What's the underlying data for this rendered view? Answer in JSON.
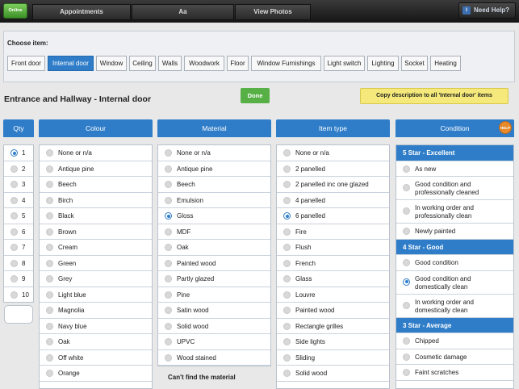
{
  "topbar": {
    "online_label": "Online",
    "tabs": [
      "Appointments",
      "Aa",
      "View Photos"
    ],
    "help_label": "Need Help?",
    "help_icon": "info-icon"
  },
  "choose": {
    "title": "Choose item:",
    "items": [
      "Front door",
      "Internal door",
      "Window",
      "Ceiling",
      "Walls",
      "Woodwork",
      "Floor",
      "Window Furnishings",
      "Light switch",
      "Lighting",
      "Socket",
      "Heating"
    ],
    "selected": "Internal door"
  },
  "section": {
    "title": "Entrance and Hallway - Internal door",
    "done_label": "Done",
    "copy_label": "Copy description to all 'Internal door' items"
  },
  "columns": {
    "qty": "Qty",
    "colour": "Colour",
    "material": "Material",
    "item_type": "Item type",
    "condition": "Condition",
    "help_badge": "HELP"
  },
  "qty": {
    "options": [
      "1",
      "2",
      "3",
      "4",
      "5",
      "6",
      "7",
      "8",
      "9",
      "10"
    ],
    "selected": "1"
  },
  "colour": {
    "options": [
      "None or n/a",
      "Antique pine",
      "Beech",
      "Birch",
      "Black",
      "Brown",
      "Cream",
      "Green",
      "Grey",
      "Light blue",
      "Magnolia",
      "Navy blue",
      "Oak",
      "Off white",
      "Orange"
    ]
  },
  "material": {
    "options": [
      "None or n/a",
      "Antique pine",
      "Beech",
      "Emulsion",
      "Gloss",
      "MDF",
      "Oak",
      "Painted wood",
      "Partly glazed",
      "Pine",
      "Satin wood",
      "Solid wood",
      "UPVC",
      "Wood stained"
    ],
    "selected": "Gloss",
    "cant_find": "Can't find the material"
  },
  "item_type": {
    "options": [
      "None or n/a",
      "2 panelled",
      "2 panelled inc one glazed",
      "4 panelled",
      "6 panelled",
      "Fire",
      "Flush",
      "French",
      "Glass",
      "Louvre",
      "Painted wood",
      "Rectangle grilles",
      "Side lights",
      "Sliding",
      "Solid wood"
    ],
    "selected": "6 panelled"
  },
  "condition": {
    "groups": [
      {
        "title": "5 Star - Excellent",
        "options": [
          "As new",
          "Good condition and professionally cleaned",
          "In working order and professionally clean",
          "Newly painted"
        ]
      },
      {
        "title": "4 Star - Good",
        "options": [
          "Good condition",
          "Good condition and domestically clean",
          "In working order and domestically clean"
        ]
      },
      {
        "title": "3 Star - Average",
        "options": [
          "Chipped",
          "Cosmetic damage",
          "Faint scratches"
        ]
      }
    ],
    "selected": "Good condition and domestically clean"
  },
  "colors": {
    "accent": "#2f7dc8",
    "done": "#56b046",
    "copy": "#f4e97a",
    "help_badge": "#e88a2b"
  }
}
